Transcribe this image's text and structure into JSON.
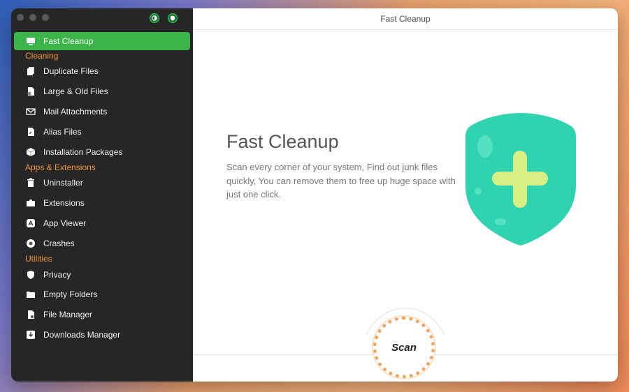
{
  "window": {
    "title": "Fast Cleanup"
  },
  "sidebar": {
    "active": {
      "label": "Fast Cleanup",
      "icon": "monitor-icon"
    },
    "sections": [
      {
        "title": "Cleaning",
        "items": [
          {
            "label": "Duplicate Files",
            "icon": "duplicate-files-icon"
          },
          {
            "label": "Large & Old Files",
            "icon": "large-files-icon"
          },
          {
            "label": "Mail Attachments",
            "icon": "mail-icon"
          },
          {
            "label": "Alias Files",
            "icon": "alias-files-icon"
          },
          {
            "label": "Installation Packages",
            "icon": "package-icon"
          }
        ]
      },
      {
        "title": "Apps & Extensions",
        "items": [
          {
            "label": "Uninstaller",
            "icon": "trash-icon"
          },
          {
            "label": "Extensions",
            "icon": "puzzle-icon"
          },
          {
            "label": "App Viewer",
            "icon": "app-store-icon"
          },
          {
            "label": "Crashes",
            "icon": "crash-icon"
          }
        ]
      },
      {
        "title": "Utilities",
        "items": [
          {
            "label": "Privacy",
            "icon": "privacy-shield-icon"
          },
          {
            "label": "Empty Folders",
            "icon": "folder-icon"
          },
          {
            "label": "File Manager",
            "icon": "file-manager-icon"
          },
          {
            "label": "Downloads Manager",
            "icon": "download-icon"
          }
        ]
      }
    ]
  },
  "main": {
    "hero_title": "Fast Cleanup",
    "hero_description": "Scan every corner of your system, Find out junk files quickly, You can remove them to free up huge space with just one click.",
    "scan_label": "Scan"
  },
  "colors": {
    "accent_green": "#3bb54a",
    "section_orange": "#f0963a",
    "shield_teal": "#2fd3b0",
    "plus_lime": "#d8ef85",
    "scan_ring": "#f1a35c"
  }
}
